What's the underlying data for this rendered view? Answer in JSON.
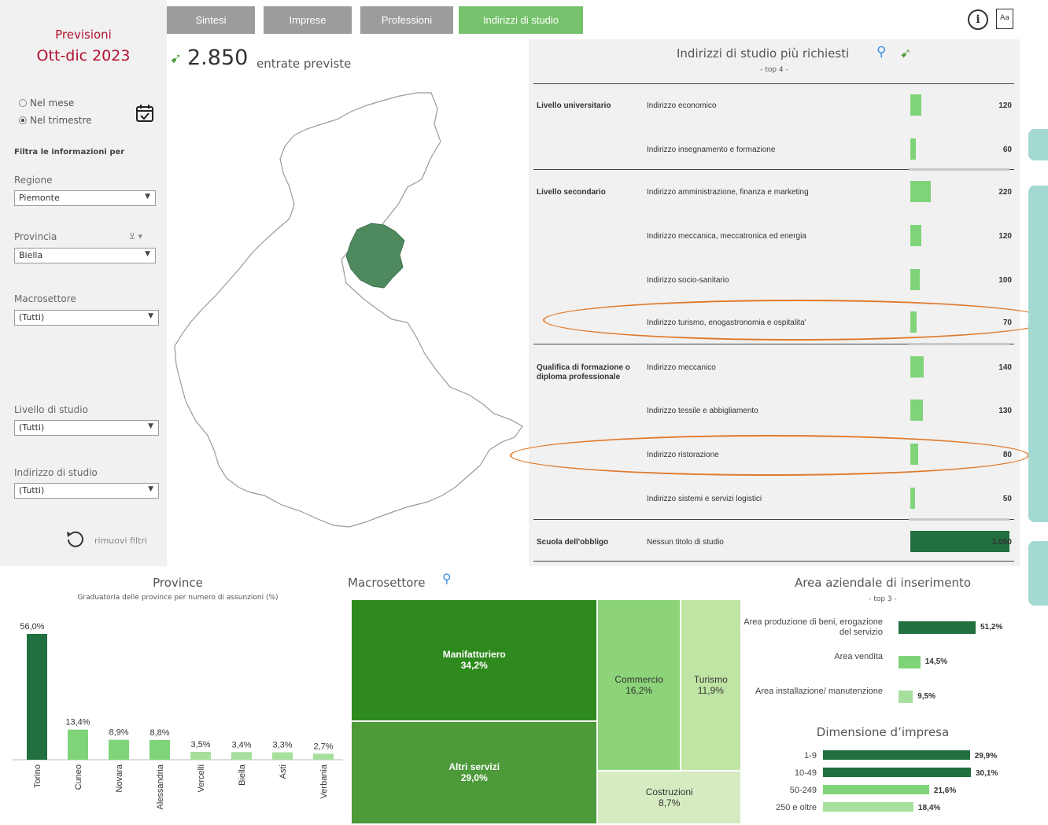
{
  "colors": {
    "dark_green": "#226f3f",
    "mid_green": "#4c9a3a",
    "light_green": "#7fd47a",
    "pale_green": "#a7df9d",
    "treemap_dark": "#2f8a1e",
    "treemap_mid": "#4c9a3a",
    "treemap_light": "#8cd379",
    "treemap_pale": "#bfe5a4",
    "treemap_palest": "#d7ebc3",
    "map_fill": "#4f8a5e",
    "accent_red": "#b2102f",
    "annotation_orange": "#e07a2c",
    "side_tab": "#a3d9d1"
  },
  "left_panel": {
    "title_top": "Previsioni",
    "title_period": "Ott-dic 2023",
    "radio_month": "Nel mese",
    "radio_quarter": "Nel trimestre",
    "filter_header": "Filtra le informazioni per",
    "regione_label": "Regione",
    "regione_value": "Piemonte",
    "provincia_label": "Provincia",
    "provincia_value": "Biella",
    "macrosettore_label": "Macrosettore",
    "macrosettore_value": "(Tutti)",
    "livello_label": "Livello di studio",
    "livello_value": "(Tutti)",
    "indirizzo_label": "Indirizzo di studio",
    "indirizzo_value": "(Tutti)",
    "reset_label": "rimuovi filtri"
  },
  "tabs": [
    {
      "label": "Sintesi"
    },
    {
      "label": "Imprese"
    },
    {
      "label": "Professioni"
    },
    {
      "label": "Indirizzi di studio"
    }
  ],
  "header": {
    "total_value": "2.850",
    "total_label": "entrate previste",
    "info_icon": "info-icon",
    "font_icon": "font-size-icon",
    "font_icon_text": "Aa"
  },
  "table": {
    "title": "Indirizzi di studio più richiesti",
    "subtitle": "- top 4 -",
    "max_value": 1050,
    "rows": [
      {
        "level": "Livello universitario",
        "indirizzo": "Indirizzo economico",
        "value": 120,
        "label": "120"
      },
      {
        "level": "",
        "indirizzo": "Indirizzo insegnamento e formazione",
        "value": 60,
        "label": "60"
      },
      {
        "level": "Livello secondario",
        "indirizzo": "Indirizzo amministrazione, finanza e marketing",
        "value": 220,
        "label": "220"
      },
      {
        "level": "",
        "indirizzo": "Indirizzo meccanica, meccatronica ed energia",
        "value": 120,
        "label": "120"
      },
      {
        "level": "",
        "indirizzo": "Indirizzo socio-sanitario",
        "value": 100,
        "label": "100"
      },
      {
        "level": "",
        "indirizzo": "Indirizzo turismo, enogastronomia e ospitalita'",
        "value": 70,
        "label": "70"
      },
      {
        "level": "Qualifica di formazione o diploma professionale",
        "indirizzo": "Indirizzo meccanico",
        "value": 140,
        "label": "140"
      },
      {
        "level": "",
        "indirizzo": "Indirizzo tessile e abbigliamento",
        "value": 130,
        "label": "130"
      },
      {
        "level": "",
        "indirizzo": "Indirizzo ristorazione",
        "value": 80,
        "label": "80"
      },
      {
        "level": "",
        "indirizzo": "Indirizzo sistemi e servizi logistici",
        "value": 50,
        "label": "50"
      },
      {
        "level": "Scuola dell'obbligo",
        "indirizzo": "Nessun titolo di studio",
        "value": 1050,
        "label": "1.050"
      }
    ]
  },
  "province_chart": {
    "title": "Province",
    "subtitle": "Graduatoria delle province per numero di assunzioni (%)",
    "chart_data": {
      "type": "bar",
      "categories": [
        "Torino",
        "Cuneo",
        "Novara",
        "Alessandria",
        "Vercelli",
        "Biella",
        "Asti",
        "Verbania"
      ],
      "values": [
        56.0,
        13.4,
        8.9,
        8.8,
        3.5,
        3.4,
        3.3,
        2.7
      ],
      "labels": [
        "56,0%",
        "13,4%",
        "8,9%",
        "8,8%",
        "3,5%",
        "3,4%",
        "3,3%",
        "2,7%"
      ],
      "ylim": [
        0,
        56
      ]
    }
  },
  "macrosettore": {
    "title": "Macrosettore",
    "chart_data": {
      "type": "treemap",
      "items": [
        {
          "name": "Manifatturiero",
          "value": 34.2,
          "label": "34,2%"
        },
        {
          "name": "Altri servizi",
          "value": 29.0,
          "label": "29,0%"
        },
        {
          "name": "Commercio",
          "value": 16.2,
          "label": "16,2%"
        },
        {
          "name": "Turismo",
          "value": 11.9,
          "label": "11,9%"
        },
        {
          "name": "Costruzioni",
          "value": 8.7,
          "label": "8,7%"
        }
      ]
    }
  },
  "area": {
    "title": "Area aziendale di inserimento",
    "subtitle": "- top 3 -",
    "chart_data": {
      "type": "bar",
      "orientation": "horizontal",
      "categories": [
        "Area produzione di beni, erogazione del servizio",
        "Area vendita",
        "Area installazione/ manutenzione"
      ],
      "values": [
        51.2,
        14.5,
        9.5
      ],
      "labels": [
        "51,2%",
        "14,5%",
        "9,5%"
      ]
    }
  },
  "dimensione": {
    "title": "Dimensione d’impresa",
    "chart_data": {
      "type": "bar",
      "orientation": "horizontal",
      "categories": [
        "1-9",
        "10-49",
        "50-249",
        "250 e oltre"
      ],
      "values": [
        29.9,
        30.1,
        21.6,
        18.4
      ],
      "labels": [
        "29,9%",
        "30,1%",
        "21,6%",
        "18,4%"
      ]
    }
  }
}
